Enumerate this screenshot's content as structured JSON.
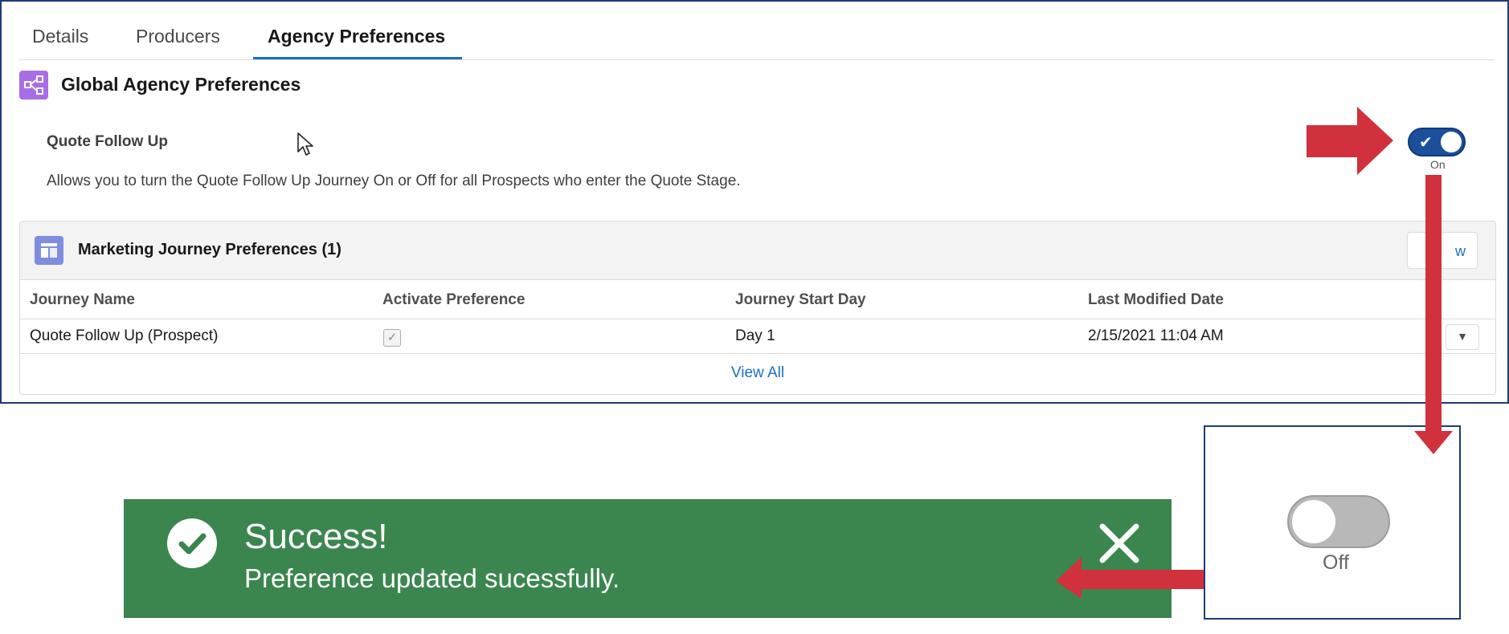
{
  "tabs": [
    {
      "label": "Details",
      "active": false
    },
    {
      "label": "Producers",
      "active": false
    },
    {
      "label": "Agency Preferences",
      "active": true
    }
  ],
  "global_section": {
    "title": "Global Agency Preferences",
    "icon": "hierarchy-icon",
    "icon_color": "#a86ee5"
  },
  "quote_follow_up": {
    "label": "Quote Follow Up",
    "description": "Allows you to turn the Quote Follow Up Journey On or Off for all Prospects who enter the Quote Stage.",
    "toggle_state_label": "On"
  },
  "related_list": {
    "title": "Marketing Journey Preferences (1)",
    "icon": "table-icon",
    "icon_color": "#7f8de1",
    "button_label": "w",
    "columns": [
      "Journey Name",
      "Activate Preference",
      "Journey Start Day",
      "Last Modified Date"
    ],
    "rows": [
      {
        "journey_name": "Quote Follow Up (Prospect)",
        "activate": true,
        "start_day": "Day 1",
        "modified": "2/15/2021 11:04 AM"
      }
    ],
    "view_all": "View All"
  },
  "toast": {
    "title": "Success!",
    "message": "Preference updated sucessfully.",
    "color": "#3b854f"
  },
  "off_inset": {
    "toggle_state_label": "Off"
  },
  "accent_colors": {
    "arrow": "#d0313c",
    "toggle_on": "#1b4f9c",
    "link": "#1b6ec2"
  }
}
